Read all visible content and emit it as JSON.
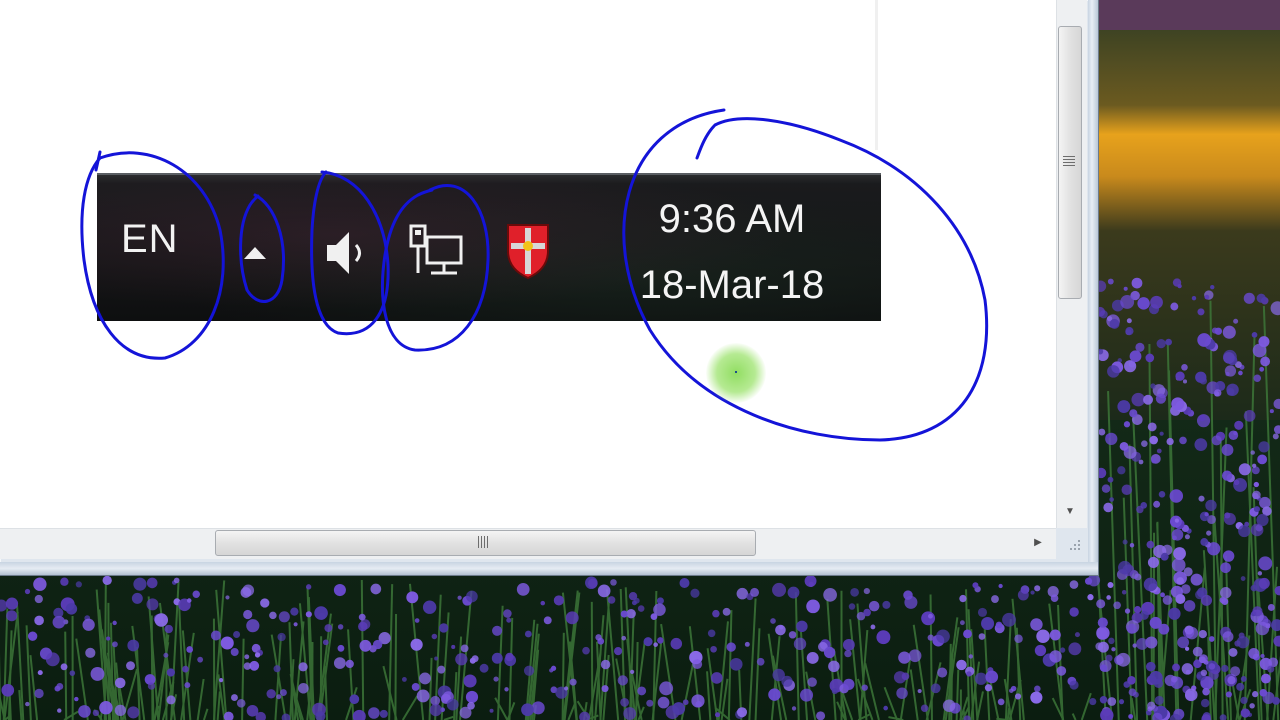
{
  "taskbar": {
    "language": "EN",
    "clock": {
      "time": "9:36 AM",
      "date": "18-Mar-18"
    },
    "tray_icons": [
      "show-hidden-icons-arrow",
      "volume-icon",
      "network-icon",
      "security-shield-icon"
    ]
  },
  "colors": {
    "annotation_ink": "#1414d8",
    "cursor_highlight": "#8fdc5a",
    "taskbar_background": "#141516",
    "security_shield_red": "#e0202a"
  },
  "scrollbars": {
    "vertical_position": 0.0,
    "horizontal_position": 0.27
  }
}
